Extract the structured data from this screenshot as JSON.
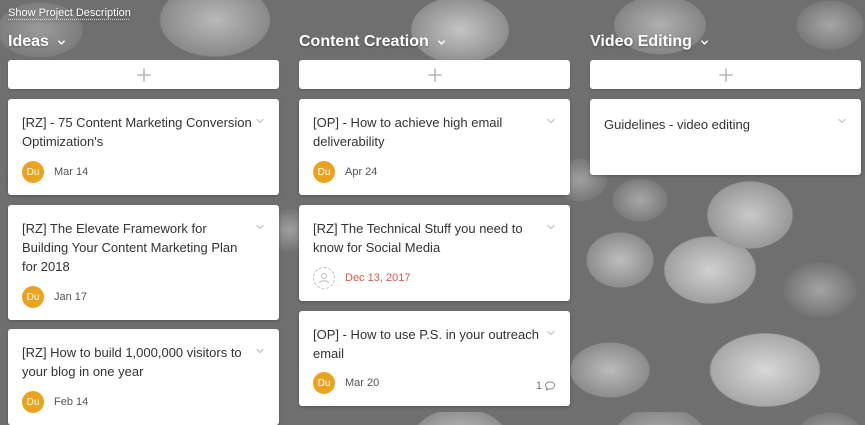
{
  "topbar": {
    "show_description": "Show Project Description"
  },
  "columns": [
    {
      "title": "Ideas",
      "cards": [
        {
          "title": "[RZ] - 75 Content Marketing Conversion Optimization's",
          "avatar": "Du",
          "date": "Mar 14"
        },
        {
          "title": "[RZ] The Elevate Framework for Building Your Content Marketing Plan for 2018",
          "avatar": "Du",
          "date": "Jan 17"
        },
        {
          "title": "[RZ] How to build 1,000,000 visitors to your blog in one year",
          "avatar": "Du",
          "date": "Feb 14"
        }
      ]
    },
    {
      "title": "Content Creation",
      "cards": [
        {
          "title": "[OP] - How to achieve high email deliverability",
          "avatar": "Du",
          "date": "Apr 24"
        },
        {
          "title": "[RZ] The Technical Stuff you need to know for Social Media",
          "avatar": "",
          "date": "Dec 13, 2017"
        },
        {
          "title": "[OP] - How to use P.S. in your outreach email",
          "avatar": "Du",
          "date": "Mar 20",
          "comments": "1"
        }
      ]
    },
    {
      "title": "Video Editing",
      "cards": [
        {
          "title": "Guidelines - video editing"
        }
      ]
    }
  ],
  "colors": {
    "avatar": "#e9a31f",
    "overdue": "#d9534f",
    "card": "#ffffff",
    "header_text": "#ffffff"
  },
  "icons": {
    "dropdown": "chevron-down-icon",
    "add": "plus-icon",
    "comment": "comment-icon",
    "unassigned": "user-placeholder-icon"
  }
}
